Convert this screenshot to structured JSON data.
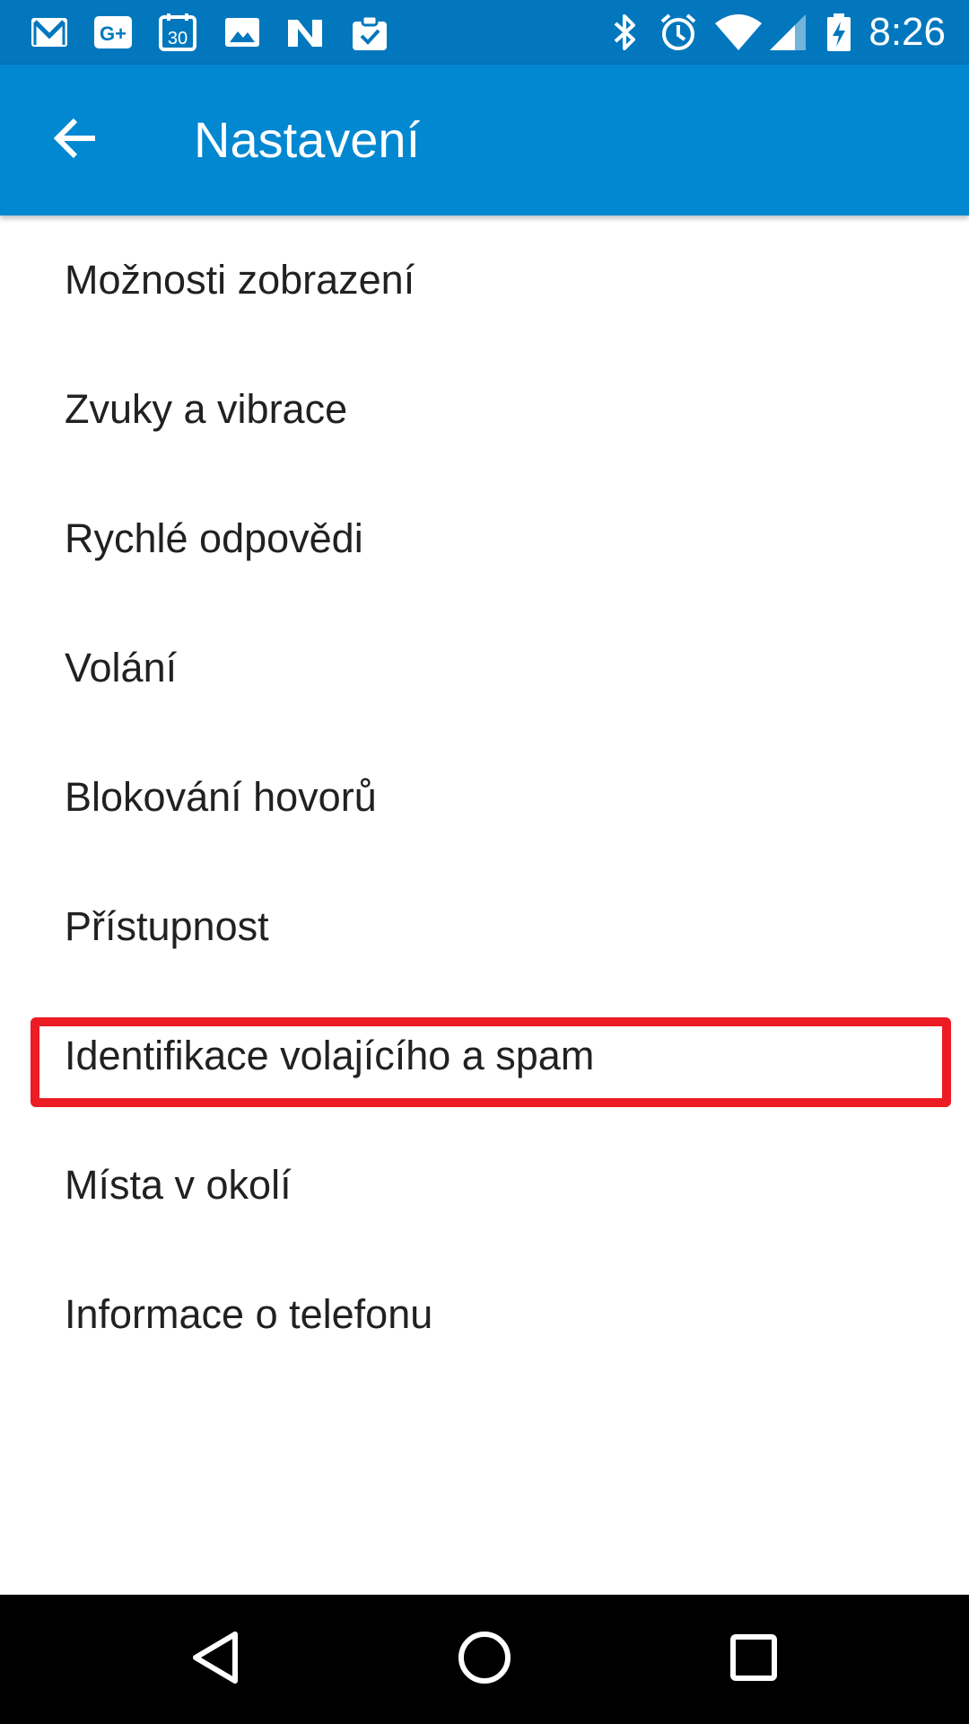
{
  "status_bar": {
    "time": "8:26",
    "left_icons": [
      "gmail-icon",
      "google-plus-icon",
      "calendar-icon",
      "gallery-icon",
      "nova-icon",
      "clipboard-check-icon"
    ],
    "right_icons": [
      "bluetooth-icon",
      "alarm-icon",
      "wifi-icon",
      "cell-signal-icon",
      "battery-charging-icon"
    ],
    "calendar_day": "30",
    "gplus_label": "G+"
  },
  "app_bar": {
    "title": "Nastavení",
    "back_icon": "arrow-back-icon"
  },
  "settings": {
    "items": [
      {
        "label": "Možnosti zobrazení"
      },
      {
        "label": "Zvuky a vibrace"
      },
      {
        "label": "Rychlé odpovědi"
      },
      {
        "label": "Volání"
      },
      {
        "label": "Blokování hovorů"
      },
      {
        "label": "Přístupnost"
      },
      {
        "label": "Identifikace volajícího a spam"
      },
      {
        "label": "Místa v okolí"
      },
      {
        "label": "Informace o telefonu"
      }
    ],
    "highlighted_item": "Identifikace volajícího a spam"
  },
  "nav_bar": {
    "buttons": [
      "back-triangle-icon",
      "home-circle-icon",
      "recents-square-icon"
    ]
  },
  "colors": {
    "status_bar": "#0277bd",
    "app_bar": "#0288d1",
    "highlight": "#ec1c24",
    "text": "#212121"
  }
}
